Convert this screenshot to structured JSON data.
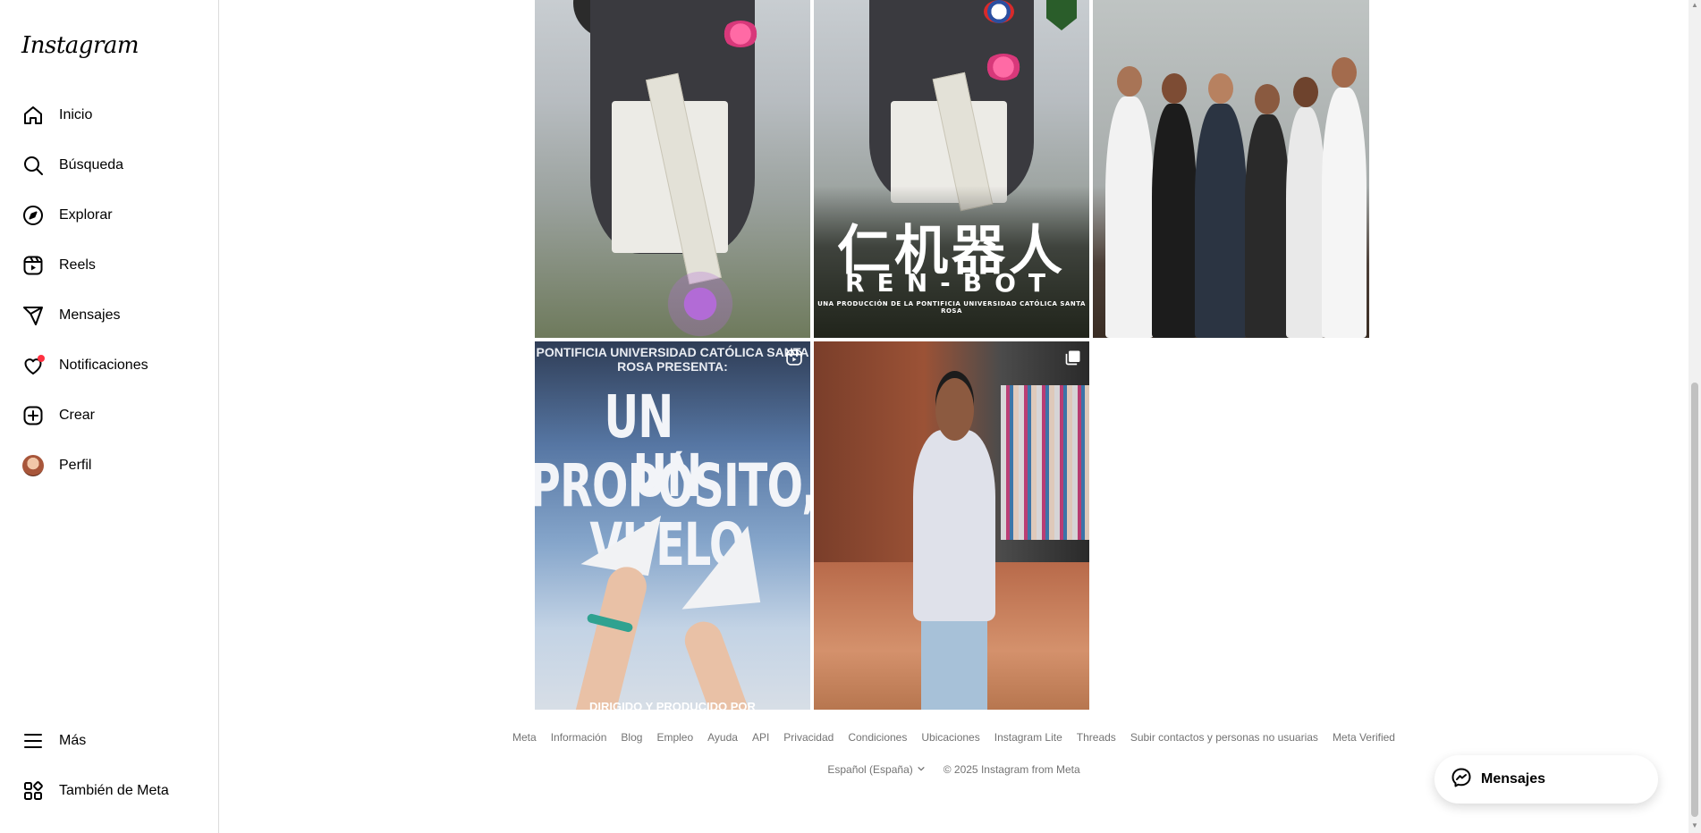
{
  "sidebar": {
    "logo": "Instagram",
    "items": [
      {
        "label": "Inicio",
        "icon": "home-icon"
      },
      {
        "label": "Búsqueda",
        "icon": "search-icon"
      },
      {
        "label": "Explorar",
        "icon": "compass-icon"
      },
      {
        "label": "Reels",
        "icon": "reels-icon"
      },
      {
        "label": "Mensajes",
        "icon": "messenger-icon"
      },
      {
        "label": "Notificaciones",
        "icon": "heart-icon"
      },
      {
        "label": "Crear",
        "icon": "plus-square-icon"
      },
      {
        "label": "Perfil",
        "icon": "avatar"
      }
    ],
    "bottom": [
      {
        "label": "Más",
        "icon": "hamburger-icon"
      },
      {
        "label": "También de Meta",
        "icon": "meta-apps-icon"
      }
    ]
  },
  "posts": {
    "poster_cn": "仁机器人",
    "poster_en": "REN-BOT",
    "poster_sub": "UNA PRODUCCIÓN DE LA PONTIFICIA UNIVERSIDAD CATÓLICA SANTA ROSA",
    "plane_header": "PONTIFICIA UNIVERSIDAD CATÓLICA SANTA ROSA PRESENTA:",
    "plane_title_1": "UN PROPÓSITO,",
    "plane_title_2": "UN VUELO",
    "plane_footer": "DIRIGIDO Y PRODUCIDO POR"
  },
  "footer": {
    "links": [
      "Meta",
      "Información",
      "Blog",
      "Empleo",
      "Ayuda",
      "API",
      "Privacidad",
      "Condiciones",
      "Ubicaciones",
      "Instagram Lite",
      "Threads",
      "Subir contactos y personas no usuarias",
      "Meta Verified"
    ],
    "language": "Español (España)",
    "copyright": "© 2025 Instagram from Meta"
  },
  "messages_button": {
    "label": "Mensajes"
  },
  "colors": {
    "notification_dot": "#ff3040",
    "footer_text": "#737373",
    "border": "#dbdbdb"
  }
}
